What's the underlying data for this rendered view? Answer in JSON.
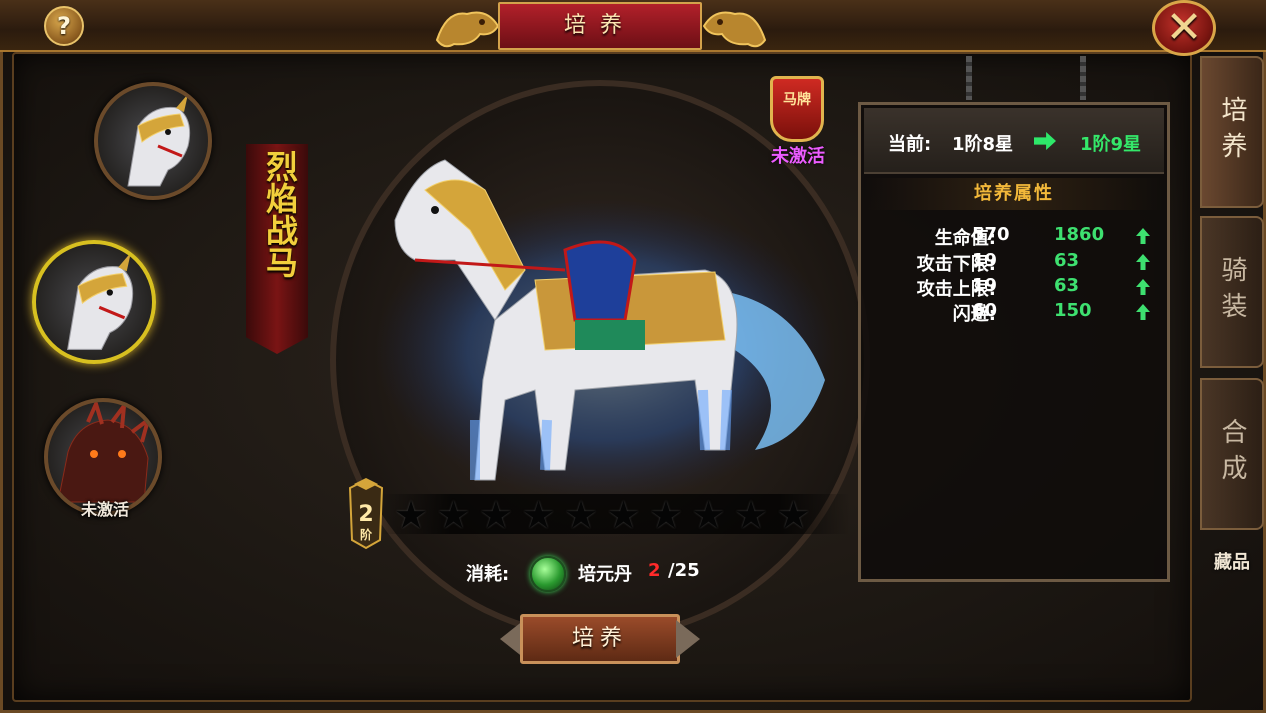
{
  "header": {
    "title": "培养",
    "help_symbol": "?",
    "close_symbol": "✕"
  },
  "mounts": [
    {
      "name": "white-armored-horse",
      "selected": false,
      "status": ""
    },
    {
      "name": "white-armored-horse-selected",
      "selected": true,
      "status": ""
    },
    {
      "name": "dragon-beast",
      "selected": false,
      "status": "未激活"
    }
  ],
  "mount_name": "烈焰战马",
  "badge": {
    "text": "马牌",
    "status": "未激活"
  },
  "stage": {
    "number": "2",
    "unit": "阶",
    "stars_total": 10,
    "stars_lit": 0
  },
  "cost": {
    "label": "消耗:",
    "item_name": "培元丹",
    "have": "2",
    "need": "/25"
  },
  "train_button": "培养",
  "panel": {
    "current_label": "当前:",
    "current_value": "1阶8星",
    "next_value": "1阶9星",
    "attr_title": "培养属性",
    "stats": [
      {
        "label": "生命值:",
        "current": "570",
        "next": "1860"
      },
      {
        "label": "攻击下限:",
        "current": "19",
        "next": "63"
      },
      {
        "label": "攻击上限:",
        "current": "19",
        "next": "63"
      },
      {
        "label": "闪避:",
        "current": "60",
        "next": "150"
      }
    ]
  },
  "tabs": [
    {
      "label": "培养",
      "active": true
    },
    {
      "label": "骑装",
      "active": false
    },
    {
      "label": "合成",
      "active": false
    }
  ],
  "collection_tab": "藏品",
  "colors": {
    "gold": "#e9c36a",
    "red": "#b2202a",
    "green": "#3ee070",
    "purple": "#ec5cff"
  }
}
